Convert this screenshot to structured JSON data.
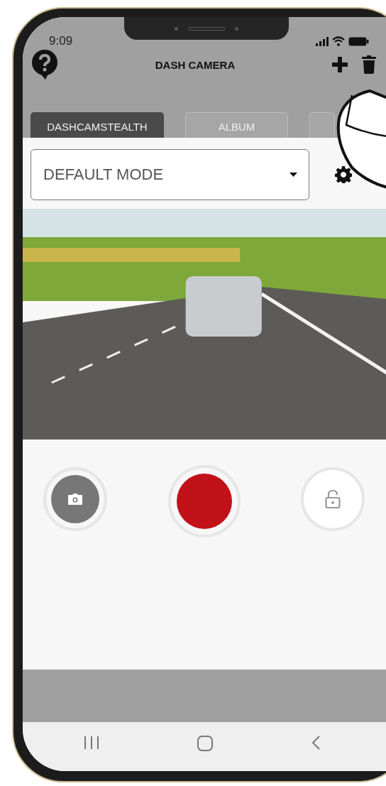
{
  "status_bar": {
    "time": "9:09"
  },
  "header": {
    "title": "DASH CAMERA"
  },
  "tabs": [
    {
      "label": "DASHCAMSTEALTH",
      "selected": true
    },
    {
      "label": "ALBUM",
      "selected": false
    },
    {
      "selected": false
    }
  ],
  "mode_select": {
    "value": "DEFAULT MODE"
  }
}
